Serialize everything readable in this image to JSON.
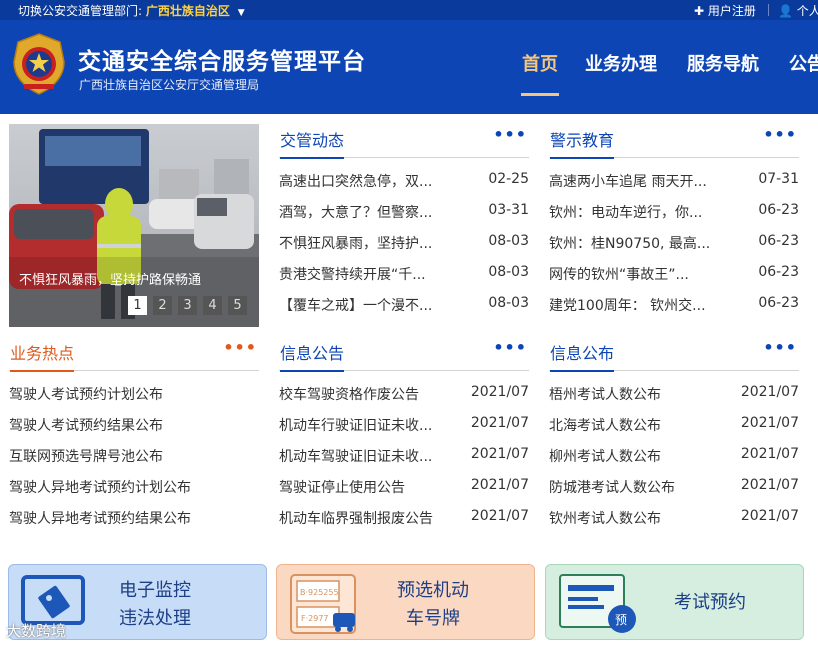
{
  "topbar": {
    "dept_label": "切换公安交通管理部门:",
    "dept_value": "广西壮族自治区",
    "register": "用户注册",
    "personal": "个人"
  },
  "header": {
    "title": "交通安全综合服务管理平台",
    "subtitle": "广西壮族自治区公安厅交通管理局",
    "nav": [
      "首页",
      "业务办理",
      "服务导航",
      "公告"
    ]
  },
  "carousel": {
    "caption": "不惧狂风暴雨，坚持护路保畅通",
    "pages": [
      "1",
      "2",
      "3",
      "4",
      "5"
    ],
    "active_page": 1
  },
  "panels": {
    "traffic_news": {
      "title": "交管动态",
      "more": "•••",
      "items": [
        {
          "text": "高速出口突然急停，双...",
          "date": "02-25"
        },
        {
          "text": "酒驾，大意了？但警察...",
          "date": "03-31"
        },
        {
          "text": "不惧狂风暴雨，坚持护...",
          "date": "08-03"
        },
        {
          "text": "贵港交警持续开展“千...",
          "date": "08-03"
        },
        {
          "text": "【覆车之戒】一个漫不...",
          "date": "08-03"
        }
      ]
    },
    "warning_edu": {
      "title": "警示教育",
      "more": "•••",
      "items": [
        {
          "text": "高速两小车追尾 雨天开...",
          "date": "07-31"
        },
        {
          "text": "钦州：电动车逆行，你...",
          "date": "06-23"
        },
        {
          "text": "钦州：桂N90750, 最高...",
          "date": "06-23"
        },
        {
          "text": "网传的钦州“事故王”...",
          "date": "06-23"
        },
        {
          "text": "建党100周年： 钦州交...",
          "date": "06-23"
        }
      ]
    },
    "hot_business": {
      "title": "业务热点",
      "more": "•••",
      "items": [
        {
          "text": "驾驶人考试预约计划公布"
        },
        {
          "text": "驾驶人考试预约结果公布"
        },
        {
          "text": "互联网预选号牌号池公布"
        },
        {
          "text": "驾驶人异地考试预约计划公布"
        },
        {
          "text": "驾驶人异地考试预约结果公布"
        }
      ]
    },
    "info_notice": {
      "title": "信息公告",
      "more": "•••",
      "items": [
        {
          "text": "校车驾驶资格作废公告",
          "date": "2021/07"
        },
        {
          "text": "机动车行驶证旧证未收...",
          "date": "2021/07"
        },
        {
          "text": "机动车驾驶证旧证未收...",
          "date": "2021/07"
        },
        {
          "text": "驾驶证停止使用公告",
          "date": "2021/07"
        },
        {
          "text": "机动车临界强制报废公告",
          "date": "2021/07"
        }
      ]
    },
    "info_publish": {
      "title": "信息公布",
      "more": "•••",
      "items": [
        {
          "text": "梧州考试人数公布",
          "date": "2021/07"
        },
        {
          "text": "北海考试人数公布",
          "date": "2021/07"
        },
        {
          "text": "柳州考试人数公布",
          "date": "2021/07"
        },
        {
          "text": "防城港考试人数公布",
          "date": "2021/07"
        },
        {
          "text": "钦州考试人数公布",
          "date": "2021/07"
        }
      ]
    }
  },
  "services": {
    "electronic_monitoring": {
      "line1": "电子监控",
      "line2": "违法处理"
    },
    "plate_preselect": {
      "line1": "预选机动",
      "line2": "车号牌",
      "plate1": "B·925255",
      "plate2": "F·2977"
    },
    "exam_booking": {
      "label": "考试预约",
      "badge": "预"
    }
  },
  "watermark": "大数跨境",
  "colors": {
    "topbar": "#0a3a9b",
    "header": "#0d45b5",
    "nav_active": "#f5c77e",
    "accent_blue": "#0d45b5",
    "accent_orange": "#e05a1c",
    "region_highlight": "#ffd23f"
  }
}
